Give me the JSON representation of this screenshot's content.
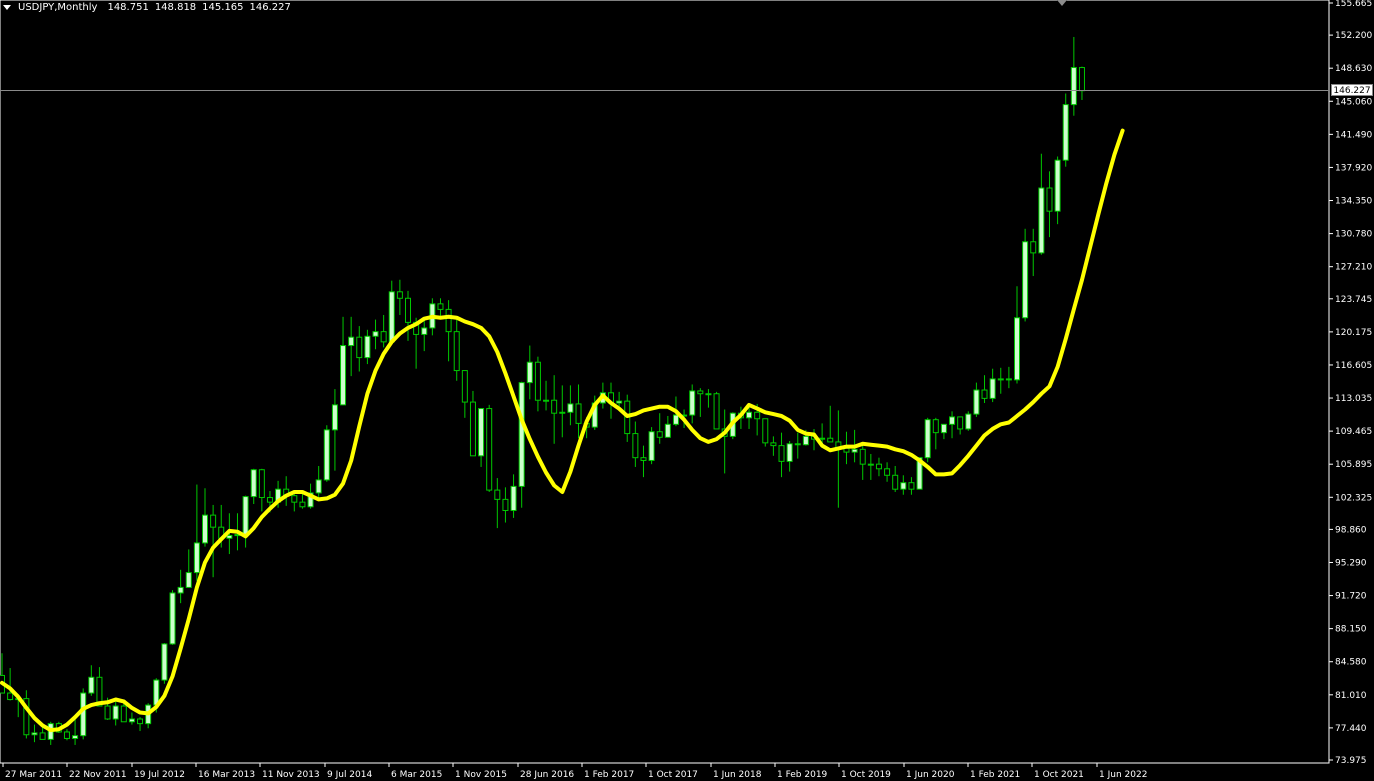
{
  "header": {
    "symbol": "USDJPY,Monthly",
    "open": "148.751",
    "high": "148.818",
    "low": "145.165",
    "close": "146.227"
  },
  "current_price_label": "146.227",
  "colors": {
    "background": "#000000",
    "candle": "#00c800",
    "bull_body": "#ccffcc",
    "ma_line": "#ffff00",
    "price_line": "#8a8a8a",
    "axis_text": "#ffffff"
  },
  "chart_data": {
    "type": "candlestick",
    "title": "USDJPY,Monthly",
    "y_ticks": [
      "155.665",
      "152.200",
      "148.630",
      "145.060",
      "141.490",
      "137.920",
      "134.350",
      "130.780",
      "127.210",
      "123.745",
      "120.175",
      "116.605",
      "113.035",
      "109.465",
      "105.895",
      "102.325",
      "98.860",
      "95.290",
      "91.720",
      "88.150",
      "84.580",
      "81.010",
      "77.440",
      "73.975"
    ],
    "ylim": [
      73.975,
      155.665
    ],
    "x_ticks": [
      "27 Mar 2011",
      "22 Nov 2011",
      "19 Jul 2012",
      "16 Mar 2013",
      "11 Nov 2013",
      "9 Jul 2014",
      "6 Mar 2015",
      "1 Nov 2015",
      "28 Jun 2016",
      "1 Feb 2017",
      "1 Oct 2017",
      "1 Jun 2018",
      "1 Feb 2019",
      "1 Oct 2019",
      "1 Jun 2020",
      "1 Feb 2021",
      "1 Oct 2021",
      "1 Jun 2022"
    ],
    "ohlc": [
      [
        83.1,
        85.5,
        81.8,
        81.2
      ],
      [
        81.2,
        83.9,
        80.4,
        80.5
      ],
      [
        80.5,
        81.1,
        78.6,
        80.6
      ],
      [
        80.6,
        81.5,
        76.3,
        76.7
      ],
      [
        76.7,
        77.8,
        75.9,
        76.9
      ],
      [
        76.9,
        77.5,
        76.6,
        76.2
      ],
      [
        76.2,
        78.1,
        75.6,
        77.9
      ],
      [
        77.9,
        78.1,
        76.9,
        77.0
      ],
      [
        77.0,
        77.3,
        76.1,
        76.3
      ],
      [
        76.3,
        78.4,
        75.6,
        76.6
      ],
      [
        76.6,
        81.7,
        76.2,
        81.2
      ],
      [
        81.2,
        84.2,
        80.9,
        82.9
      ],
      [
        82.9,
        84.0,
        79.8,
        79.8
      ],
      [
        79.8,
        80.7,
        78.3,
        78.4
      ],
      [
        78.4,
        80.4,
        77.7,
        79.8
      ],
      [
        79.8,
        80.2,
        78.3,
        78.1
      ],
      [
        78.1,
        79.1,
        77.8,
        78.4
      ],
      [
        78.4,
        78.6,
        77.1,
        77.9
      ],
      [
        77.9,
        80.1,
        77.4,
        79.9
      ],
      [
        79.9,
        82.8,
        79.1,
        82.6
      ],
      [
        82.6,
        86.6,
        82.2,
        86.5
      ],
      [
        86.5,
        92.3,
        86.4,
        92.0
      ],
      [
        92.0,
        94.5,
        90.9,
        92.6
      ],
      [
        92.6,
        96.7,
        92.6,
        94.2
      ],
      [
        94.2,
        103.7,
        93.3,
        97.4
      ],
      [
        97.4,
        103.3,
        97.0,
        100.4
      ],
      [
        100.4,
        101.5,
        93.7,
        99.1
      ],
      [
        99.1,
        101.5,
        96.9,
        97.9
      ],
      [
        97.9,
        100.6,
        96.2,
        98.2
      ],
      [
        98.2,
        100.6,
        96.6,
        98.3
      ],
      [
        98.3,
        102.5,
        96.9,
        102.4
      ],
      [
        102.4,
        105.4,
        101.6,
        105.3
      ],
      [
        105.3,
        105.4,
        100.8,
        102.3
      ],
      [
        102.3,
        103.0,
        100.7,
        101.8
      ],
      [
        101.8,
        104.1,
        101.2,
        103.2
      ],
      [
        103.2,
        104.6,
        101.4,
        102.5
      ],
      [
        102.5,
        103.0,
        100.8,
        101.8
      ],
      [
        101.8,
        102.8,
        101.1,
        101.3
      ],
      [
        101.3,
        103.8,
        101.1,
        102.8
      ],
      [
        102.8,
        105.7,
        102.1,
        104.2
      ],
      [
        104.2,
        110.1,
        104.0,
        109.6
      ],
      [
        109.6,
        114.0,
        105.2,
        112.3
      ],
      [
        112.3,
        121.8,
        112.3,
        118.7
      ],
      [
        118.7,
        121.8,
        115.4,
        119.6
      ],
      [
        119.6,
        120.8,
        115.9,
        117.4
      ],
      [
        117.4,
        120.4,
        116.7,
        119.7
      ],
      [
        119.7,
        121.5,
        118.3,
        120.2
      ],
      [
        120.2,
        122.0,
        118.5,
        119.1
      ],
      [
        119.1,
        125.7,
        118.8,
        124.5
      ],
      [
        124.5,
        125.8,
        122.0,
        123.8
      ],
      [
        123.8,
        124.6,
        119.2,
        121.2
      ],
      [
        121.2,
        121.7,
        116.2,
        119.9
      ],
      [
        119.9,
        121.7,
        118.1,
        120.6
      ],
      [
        120.6,
        123.8,
        119.8,
        123.2
      ],
      [
        123.2,
        123.8,
        121.9,
        122.6
      ],
      [
        122.6,
        123.6,
        117.0,
        120.2
      ],
      [
        120.2,
        121.5,
        114.9,
        116.0
      ],
      [
        116.0,
        114.9,
        110.9,
        112.6
      ],
      [
        112.6,
        113.8,
        107.6,
        106.8
      ],
      [
        106.8,
        111.9,
        105.6,
        111.9
      ],
      [
        111.9,
        112.3,
        102.9,
        103.1
      ],
      [
        103.1,
        104.4,
        99.0,
        102.1
      ],
      [
        102.1,
        103.4,
        99.6,
        100.9
      ],
      [
        100.9,
        104.8,
        100.1,
        103.5
      ],
      [
        103.5,
        114.8,
        101.2,
        114.7
      ],
      [
        114.7,
        118.7,
        112.9,
        116.9
      ],
      [
        116.9,
        117.5,
        111.6,
        112.8
      ],
      [
        112.8,
        114.9,
        111.7,
        112.8
      ],
      [
        112.8,
        115.5,
        108.1,
        111.4
      ],
      [
        111.4,
        114.4,
        108.8,
        111.5
      ],
      [
        111.5,
        114.4,
        110.1,
        112.4
      ],
      [
        112.4,
        114.5,
        108.7,
        110.3
      ],
      [
        110.3,
        111.0,
        108.7,
        109.9
      ],
      [
        109.9,
        113.3,
        109.6,
        112.5
      ],
      [
        112.5,
        114.7,
        111.9,
        113.6
      ],
      [
        113.6,
        114.7,
        110.8,
        112.5
      ],
      [
        112.5,
        113.7,
        112.0,
        112.7
      ],
      [
        112.7,
        113.4,
        108.3,
        109.2
      ],
      [
        109.2,
        110.5,
        105.6,
        106.6
      ],
      [
        106.6,
        107.9,
        104.5,
        106.3
      ],
      [
        106.3,
        109.9,
        105.9,
        109.4
      ],
      [
        109.4,
        111.4,
        108.1,
        108.8
      ],
      [
        108.8,
        111.1,
        109.0,
        110.2
      ],
      [
        110.2,
        113.2,
        110.0,
        111.2
      ],
      [
        111.2,
        111.8,
        109.8,
        111.2
      ],
      [
        111.2,
        114.5,
        110.3,
        113.8
      ],
      [
        113.8,
        114.1,
        111.0,
        113.5
      ],
      [
        113.5,
        114.0,
        112.0,
        113.5
      ],
      [
        113.5,
        113.7,
        110.3,
        109.7
      ],
      [
        109.7,
        111.8,
        104.9,
        108.9
      ],
      [
        108.9,
        111.5,
        108.6,
        111.4
      ],
      [
        111.4,
        112.1,
        109.7,
        110.9
      ],
      [
        110.9,
        112.2,
        109.7,
        111.5
      ],
      [
        111.5,
        112.4,
        109.0,
        110.8
      ],
      [
        110.8,
        110.2,
        107.8,
        108.2
      ],
      [
        108.2,
        108.9,
        106.8,
        107.9
      ],
      [
        107.9,
        109.3,
        104.5,
        106.2
      ],
      [
        106.2,
        108.4,
        105.1,
        108.1
      ],
      [
        108.1,
        109.3,
        106.5,
        108.0
      ],
      [
        108.0,
        109.6,
        107.9,
        108.9
      ],
      [
        108.9,
        109.7,
        107.4,
        108.6
      ],
      [
        108.6,
        110.3,
        107.7,
        108.7
      ],
      [
        108.7,
        112.2,
        108.3,
        108.3
      ],
      [
        108.3,
        111.7,
        101.2,
        107.6
      ],
      [
        107.6,
        109.4,
        105.9,
        107.2
      ],
      [
        107.2,
        109.6,
        106.1,
        107.5
      ],
      [
        107.5,
        108.2,
        104.2,
        105.9
      ],
      [
        105.9,
        107.0,
        104.2,
        105.9
      ],
      [
        105.9,
        106.6,
        104.6,
        105.4
      ],
      [
        105.4,
        106.1,
        104.0,
        104.7
      ],
      [
        104.7,
        105.7,
        102.9,
        103.2
      ],
      [
        103.2,
        104.7,
        102.6,
        103.9
      ],
      [
        103.9,
        104.5,
        102.6,
        103.2
      ],
      [
        103.2,
        106.6,
        103.2,
        106.6
      ],
      [
        106.6,
        110.9,
        106.1,
        110.7
      ],
      [
        110.7,
        110.9,
        107.5,
        109.3
      ],
      [
        109.3,
        110.2,
        108.6,
        110.2
      ],
      [
        110.2,
        111.6,
        108.7,
        111.0
      ],
      [
        111.0,
        110.7,
        109.1,
        109.7
      ],
      [
        109.7,
        111.6,
        109.5,
        111.3
      ],
      [
        111.3,
        114.7,
        111.0,
        113.9
      ],
      [
        113.9,
        115.5,
        112.5,
        113.0
      ],
      [
        113.0,
        116.2,
        112.6,
        115.1
      ],
      [
        115.1,
        116.3,
        113.5,
        115.1
      ],
      [
        115.1,
        116.4,
        114.1,
        115.0
      ],
      [
        115.0,
        125.1,
        114.6,
        121.7
      ],
      [
        121.7,
        131.3,
        121.3,
        129.9
      ],
      [
        129.9,
        131.3,
        126.2,
        128.7
      ],
      [
        128.7,
        139.4,
        128.5,
        135.7
      ],
      [
        135.7,
        137.5,
        130.4,
        133.2
      ],
      [
        133.2,
        139.1,
        131.8,
        138.7
      ],
      [
        138.7,
        145.9,
        138.0,
        144.7
      ],
      [
        144.7,
        152.0,
        143.5,
        148.7
      ],
      [
        148.7,
        148.8,
        145.2,
        146.2
      ]
    ],
    "ma_values": [
      82.3,
      81.7,
      80.8,
      79.6,
      78.5,
      77.7,
      77.2,
      77.3,
      77.8,
      78.6,
      79.5,
      79.9,
      80.1,
      80.2,
      80.5,
      80.3,
      79.6,
      79.1,
      79.0,
      79.7,
      80.9,
      83.0,
      86.0,
      89.2,
      92.6,
      95.3,
      96.9,
      97.8,
      98.7,
      98.6,
      98.1,
      99.0,
      100.2,
      101.1,
      101.9,
      102.5,
      102.9,
      102.9,
      102.5,
      102.1,
      102.2,
      102.6,
      103.8,
      106.3,
      110.0,
      113.5,
      116.0,
      117.8,
      119.1,
      120.0,
      120.6,
      121.0,
      121.6,
      121.8,
      121.7,
      121.8,
      121.7,
      121.3,
      121.0,
      120.6,
      119.7,
      118.0,
      115.7,
      113.2,
      110.7,
      108.6,
      106.7,
      105.0,
      103.6,
      102.9,
      105.1,
      107.9,
      110.5,
      112.3,
      113.3,
      112.5,
      111.9,
      111.1,
      111.3,
      111.7,
      111.9,
      112.1,
      112.1,
      111.6,
      110.7,
      109.6,
      108.7,
      108.3,
      108.6,
      109.3,
      110.4,
      111.2,
      112.3,
      111.9,
      111.5,
      111.3,
      111.1,
      110.6,
      109.6,
      109.2,
      109.1,
      107.9,
      107.4,
      107.6,
      107.8,
      107.8,
      108.1,
      108.0,
      107.9,
      107.8,
      107.5,
      107.3,
      106.9,
      106.3,
      105.6,
      104.8,
      104.8,
      104.9,
      105.8,
      106.8,
      107.9,
      109.0,
      109.7,
      110.2,
      110.4,
      111.1,
      111.8,
      112.6,
      113.5,
      114.3,
      116.4,
      119.4,
      122.6,
      125.8,
      129.3,
      132.8,
      136.2,
      139.3,
      141.9
    ]
  }
}
